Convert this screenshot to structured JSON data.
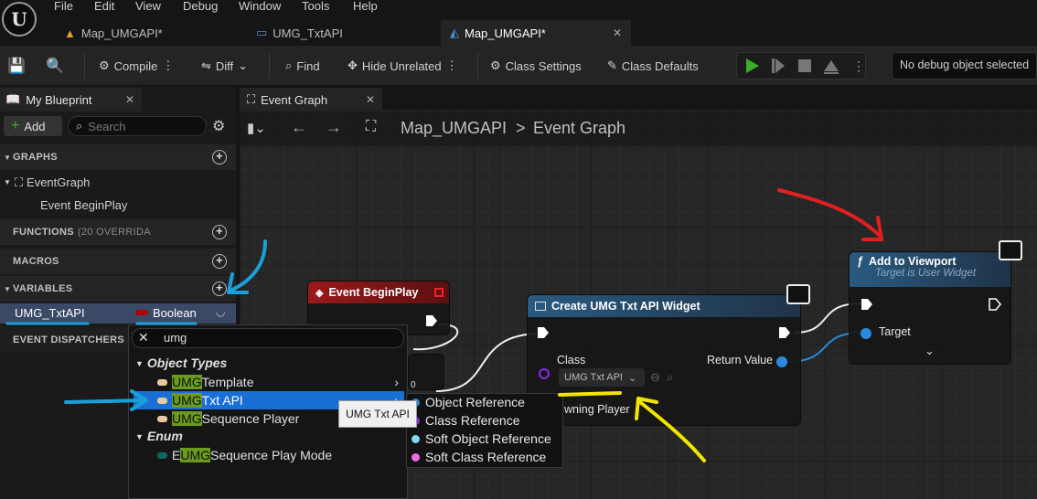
{
  "menu": [
    "File",
    "Edit",
    "View",
    "Debug",
    "Window",
    "Tools",
    "Help"
  ],
  "doc_tabs": [
    {
      "label": "Map_UMGAPI*"
    },
    {
      "label": "UMG_TxtAPI"
    },
    {
      "label": "Map_UMGAPI*"
    }
  ],
  "toolbar": {
    "compile": "Compile",
    "diff": "Diff",
    "find": "Find",
    "hide_unrelated": "Hide Unrelated",
    "class_settings": "Class Settings",
    "class_defaults": "Class Defaults",
    "debug_object": "No debug object selected"
  },
  "my_blueprint": {
    "tab": "My Blueprint",
    "add": "Add",
    "search_placeholder": "Search",
    "graphs": "GRAPHS",
    "event_graph": "EventGraph",
    "event_begin_play": "Event BeginPlay",
    "functions": "FUNCTIONS",
    "functions_note": "(20 OVERRIDA",
    "macros": "MACROS",
    "variables": "VARIABLES",
    "variable_name": "UMG_TxtAPI",
    "variable_type": "Boolean",
    "event_dispatchers": "EVENT DISPATCHERS"
  },
  "graph": {
    "tab": "Event Graph",
    "breadcrumb_root": "Map_UMGAPI",
    "breadcrumb_sep": ">",
    "breadcrumb_leaf": "Event Graph"
  },
  "nodes": {
    "begin_play": "Event BeginPlay",
    "create_widget": "Create UMG Txt API Widget",
    "class_label": "Class",
    "class_value": "UMG Txt API",
    "return_value": "Return Value",
    "owning_player": "wning Player",
    "add_viewport": "Add to Viewport",
    "add_viewport_sub": "Target is User Widget",
    "target": "Target",
    "small_zero": "0"
  },
  "type_picker": {
    "search_value": "umg",
    "category_object": "Object Types",
    "items": [
      {
        "pre": "",
        "hl": "UMG",
        "post": " Template"
      },
      {
        "pre": "",
        "hl": "UMG",
        "post": " Txt API"
      },
      {
        "pre": "",
        "hl": "UMG",
        "post": "Sequence Player"
      }
    ],
    "category_enum": "Enum",
    "enum_item": {
      "pre": "E",
      "hl": "UMG",
      "post": "Sequence Play Mode"
    },
    "tooltip": "UMG Txt API",
    "submenu": [
      "Object Reference",
      "Class Reference",
      "Soft Object Reference",
      "Soft Class Reference"
    ]
  },
  "colors": {
    "accent_blue": "#1a6fd6",
    "boolean_red": "#8b0000",
    "highlight_green": "#6a9a1f",
    "annotation_red": "#e02020",
    "annotation_blue": "#1aa0d8",
    "annotation_yellow": "#f2e600"
  }
}
